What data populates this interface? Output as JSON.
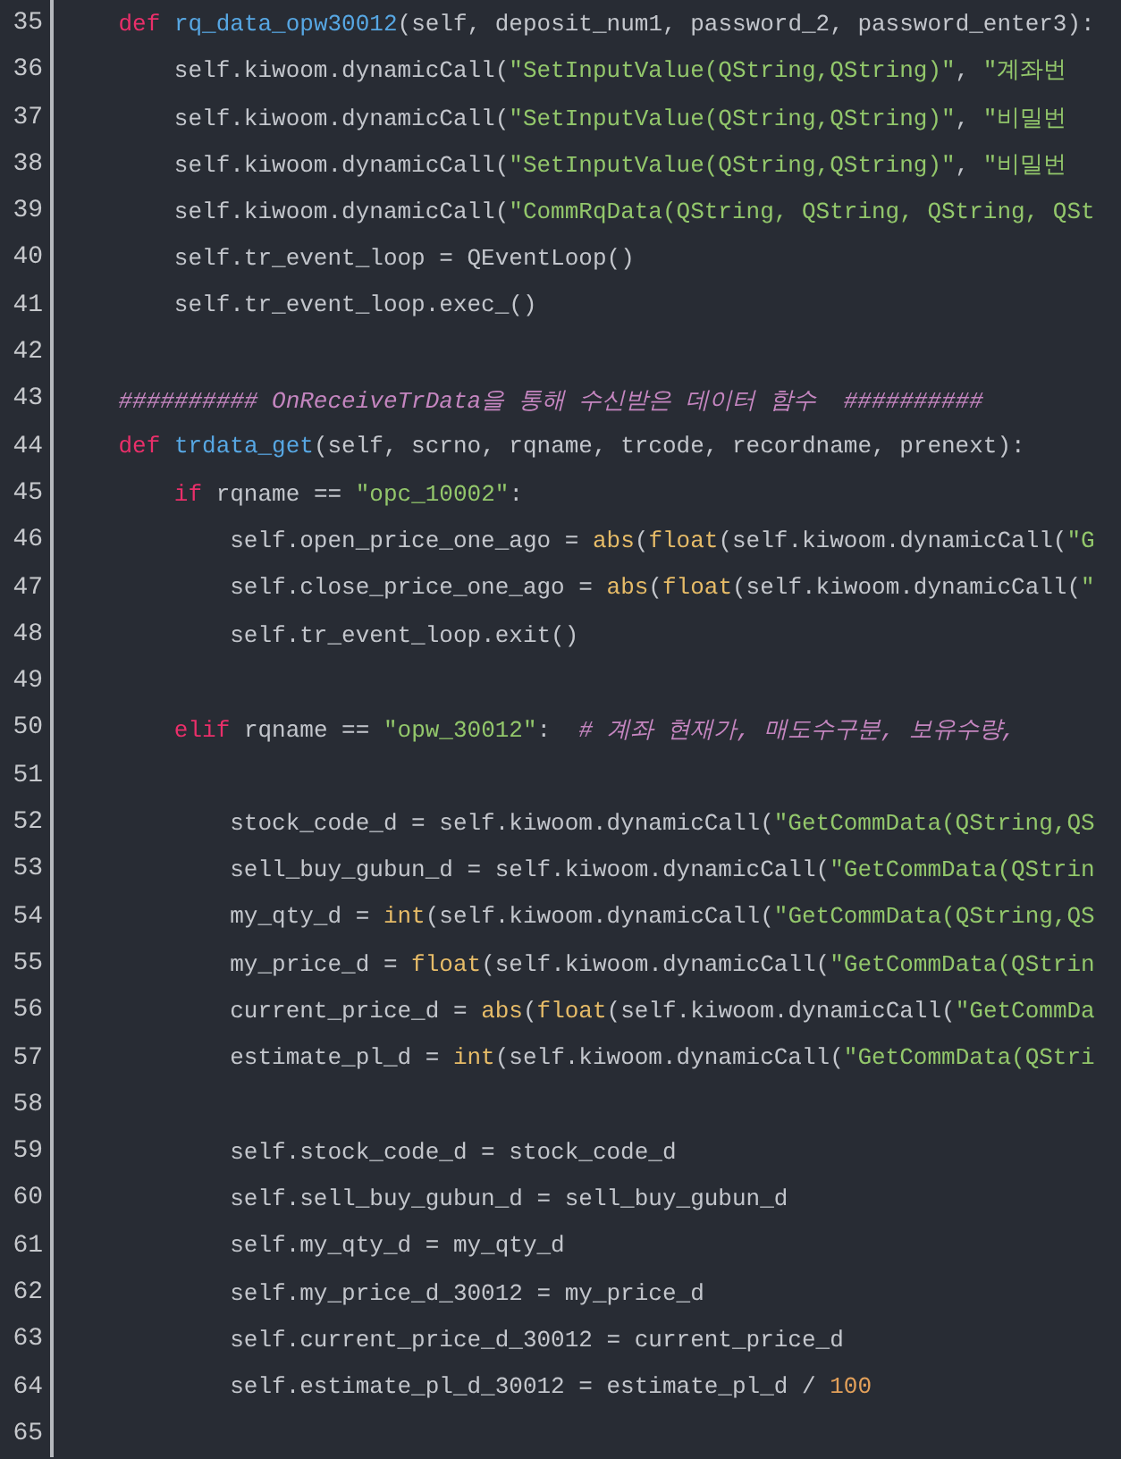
{
  "editor": {
    "lines": [
      {
        "number": "35",
        "segments": [
          {
            "kind": "keyword",
            "text": "    def "
          },
          {
            "kind": "name",
            "text": "rq_data_opw30012"
          },
          {
            "kind": "plain",
            "text": "(self, deposit_num1, password_2, password_enter3):"
          }
        ]
      },
      {
        "number": "36",
        "segments": [
          {
            "kind": "plain",
            "text": "        self.kiwoom.dynamicCall("
          },
          {
            "kind": "string",
            "text": "\"SetInputValue(QString,QString)\""
          },
          {
            "kind": "plain",
            "text": ", "
          },
          {
            "kind": "string",
            "text": "\"계좌번"
          }
        ]
      },
      {
        "number": "37",
        "segments": [
          {
            "kind": "plain",
            "text": "        self.kiwoom.dynamicCall("
          },
          {
            "kind": "string",
            "text": "\"SetInputValue(QString,QString)\""
          },
          {
            "kind": "plain",
            "text": ", "
          },
          {
            "kind": "string",
            "text": "\"비밀번"
          }
        ]
      },
      {
        "number": "38",
        "segments": [
          {
            "kind": "plain",
            "text": "        self.kiwoom.dynamicCall("
          },
          {
            "kind": "string",
            "text": "\"SetInputValue(QString,QString)\""
          },
          {
            "kind": "plain",
            "text": ", "
          },
          {
            "kind": "string",
            "text": "\"비밀번"
          }
        ]
      },
      {
        "number": "39",
        "segments": [
          {
            "kind": "plain",
            "text": "        self.kiwoom.dynamicCall("
          },
          {
            "kind": "string",
            "text": "\"CommRqData(QString, QString, QString, QSt"
          }
        ]
      },
      {
        "number": "40",
        "segments": [
          {
            "kind": "plain",
            "text": "        self.tr_event_loop = QEventLoop()"
          }
        ]
      },
      {
        "number": "41",
        "segments": [
          {
            "kind": "plain",
            "text": "        self.tr_event_loop.exec_()"
          }
        ]
      },
      {
        "number": "42"
      },
      {
        "number": "43",
        "segments": [
          {
            "kind": "comment",
            "text": "    ########## OnReceiveTrData을 통해 수신받은 데이터 함수  ##########"
          }
        ]
      },
      {
        "number": "44",
        "segments": [
          {
            "kind": "keyword",
            "text": "    def "
          },
          {
            "kind": "name",
            "text": "trdata_get"
          },
          {
            "kind": "plain",
            "text": "(self, scrno, rqname, trcode, recordname, prenext):"
          }
        ]
      },
      {
        "number": "45",
        "segments": [
          {
            "kind": "keyword",
            "text": "        if"
          },
          {
            "kind": "plain",
            "text": " rqname == "
          },
          {
            "kind": "string",
            "text": "\"opc_10002\""
          },
          {
            "kind": "plain",
            "text": ":"
          }
        ]
      },
      {
        "number": "46",
        "segments": [
          {
            "kind": "plain",
            "text": "            self.open_price_one_ago = "
          },
          {
            "kind": "builtin",
            "text": "abs"
          },
          {
            "kind": "plain",
            "text": "("
          },
          {
            "kind": "builtin",
            "text": "float"
          },
          {
            "kind": "plain",
            "text": "(self.kiwoom.dynamicCall("
          },
          {
            "kind": "string",
            "text": "\"G"
          }
        ]
      },
      {
        "number": "47",
        "segments": [
          {
            "kind": "plain",
            "text": "            self.close_price_one_ago = "
          },
          {
            "kind": "builtin",
            "text": "abs"
          },
          {
            "kind": "plain",
            "text": "("
          },
          {
            "kind": "builtin",
            "text": "float"
          },
          {
            "kind": "plain",
            "text": "(self.kiwoom.dynamicCall("
          },
          {
            "kind": "string",
            "text": "\""
          }
        ]
      },
      {
        "number": "48",
        "segments": [
          {
            "kind": "plain",
            "text": "            self.tr_event_loop.exit()"
          }
        ]
      },
      {
        "number": "49"
      },
      {
        "number": "50",
        "segments": [
          {
            "kind": "keyword",
            "text": "        elif"
          },
          {
            "kind": "plain",
            "text": " rqname == "
          },
          {
            "kind": "string",
            "text": "\"opw_30012\""
          },
          {
            "kind": "plain",
            "text": ":  "
          },
          {
            "kind": "comment",
            "text": "# 계좌 현재가, 매도수구분, 보유수량,"
          }
        ]
      },
      {
        "number": "51"
      },
      {
        "number": "52",
        "segments": [
          {
            "kind": "plain",
            "text": "            stock_code_d = self.kiwoom.dynamicCall("
          },
          {
            "kind": "string",
            "text": "\"GetCommData(QString,QS"
          }
        ]
      },
      {
        "number": "53",
        "segments": [
          {
            "kind": "plain",
            "text": "            sell_buy_gubun_d = self.kiwoom.dynamicCall("
          },
          {
            "kind": "string",
            "text": "\"GetCommData(QStrin"
          }
        ]
      },
      {
        "number": "54",
        "segments": [
          {
            "kind": "plain",
            "text": "            my_qty_d = "
          },
          {
            "kind": "builtin",
            "text": "int"
          },
          {
            "kind": "plain",
            "text": "(self.kiwoom.dynamicCall("
          },
          {
            "kind": "string",
            "text": "\"GetCommData(QString,QS"
          }
        ]
      },
      {
        "number": "55",
        "segments": [
          {
            "kind": "plain",
            "text": "            my_price_d = "
          },
          {
            "kind": "builtin",
            "text": "float"
          },
          {
            "kind": "plain",
            "text": "(self.kiwoom.dynamicCall("
          },
          {
            "kind": "string",
            "text": "\"GetCommData(QStrin"
          }
        ]
      },
      {
        "number": "56",
        "segments": [
          {
            "kind": "plain",
            "text": "            current_price_d = "
          },
          {
            "kind": "builtin",
            "text": "abs"
          },
          {
            "kind": "plain",
            "text": "("
          },
          {
            "kind": "builtin",
            "text": "float"
          },
          {
            "kind": "plain",
            "text": "(self.kiwoom.dynamicCall("
          },
          {
            "kind": "string",
            "text": "\"GetCommDa"
          }
        ]
      },
      {
        "number": "57",
        "segments": [
          {
            "kind": "plain",
            "text": "            estimate_pl_d = "
          },
          {
            "kind": "builtin",
            "text": "int"
          },
          {
            "kind": "plain",
            "text": "(self.kiwoom.dynamicCall("
          },
          {
            "kind": "string",
            "text": "\"GetCommData(QStri"
          }
        ]
      },
      {
        "number": "58"
      },
      {
        "number": "59",
        "segments": [
          {
            "kind": "plain",
            "text": "            self.stock_code_d = stock_code_d"
          }
        ]
      },
      {
        "number": "60",
        "segments": [
          {
            "kind": "plain",
            "text": "            self.sell_buy_gubun_d = sell_buy_gubun_d"
          }
        ]
      },
      {
        "number": "61",
        "segments": [
          {
            "kind": "plain",
            "text": "            self.my_qty_d = my_qty_d"
          }
        ]
      },
      {
        "number": "62",
        "segments": [
          {
            "kind": "plain",
            "text": "            self.my_price_d_30012 = my_price_d"
          }
        ]
      },
      {
        "number": "63",
        "segments": [
          {
            "kind": "plain",
            "text": "            self.current_price_d_30012 = current_price_d"
          }
        ]
      },
      {
        "number": "64",
        "segments": [
          {
            "kind": "plain",
            "text": "            self.estimate_pl_d_30012 = estimate_pl_d / "
          },
          {
            "kind": "number",
            "text": "100"
          }
        ]
      },
      {
        "number": "65"
      }
    ]
  }
}
